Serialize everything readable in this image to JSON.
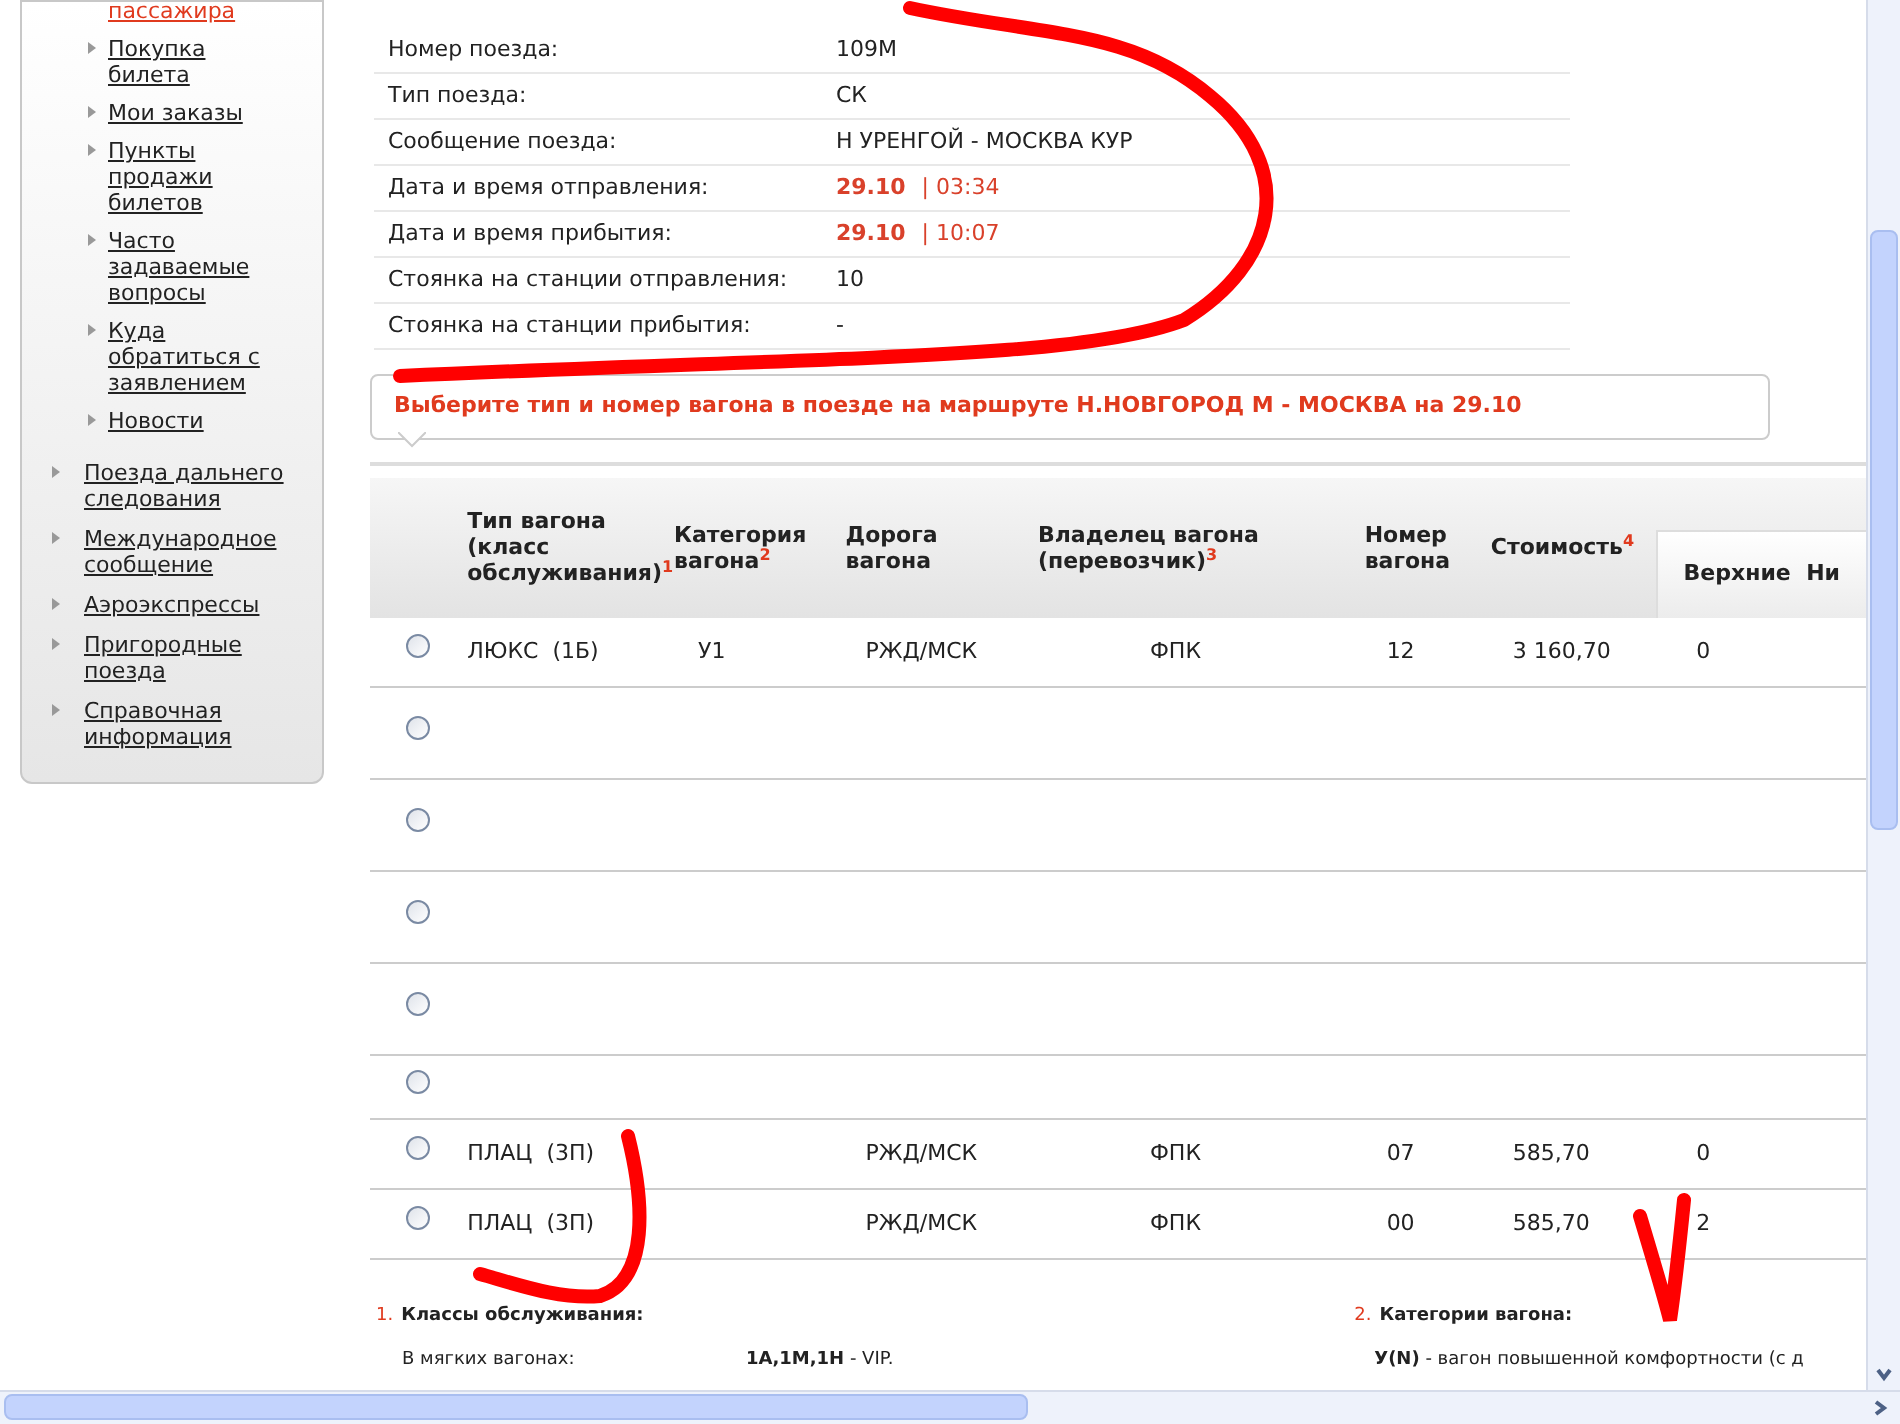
{
  "sidebar": {
    "items": [
      {
        "label": "пассажира",
        "selected": true
      },
      {
        "label": "Покупка билета",
        "selected": false
      },
      {
        "label": "Мои заказы",
        "selected": false
      },
      {
        "label": "Пункты продажи билетов",
        "selected": false
      },
      {
        "label": "Часто задаваемые вопросы",
        "selected": false
      },
      {
        "label": "Куда обратиться с заявлением",
        "selected": false
      },
      {
        "label": "Новости",
        "selected": false
      }
    ],
    "sections": [
      {
        "label": "Поезда дальнего следования"
      },
      {
        "label": "Международное сообщение"
      },
      {
        "label": "Аэроэкспрессы"
      },
      {
        "label": "Пригородные поезда"
      },
      {
        "label": "Справочная информация"
      }
    ]
  },
  "train_info": [
    {
      "label": "Номер поезда:",
      "value": "109М",
      "kind": "plain"
    },
    {
      "label": "Тип поезда:",
      "value": "СК",
      "kind": "plain"
    },
    {
      "label": "Сообщение поезда:",
      "value": "Н УРЕНГОЙ - МОСКВА КУР",
      "kind": "plain"
    },
    {
      "label": "Дата и время отправления:",
      "date": "29.10",
      "time": "| 03:34",
      "kind": "datetime"
    },
    {
      "label": "Дата и время прибытия:",
      "date": "29.10",
      "time": "| 10:07",
      "kind": "datetime"
    },
    {
      "label": "Стоянка на станции отправления:",
      "value": "10",
      "kind": "plain"
    },
    {
      "label": "Стоянка на станции прибытия:",
      "value": "-",
      "kind": "plain"
    }
  ],
  "notice": "Выберите тип и номер вагона в поезде на маршруте Н.НОВГОРОД М - МОСКВА на 29.10",
  "table": {
    "columns": [
      "Тип вагона (класс обслуживания)$^{1}$",
      "Категория вагона$^{2}$",
      "Дорога вагона",
      "Владелец вагона (перевозчик)$^{3}$",
      "Номер вагона",
      "Стоимость$^{4}$"
    ],
    "subcolumns": [
      "Верхние",
      "Ни"
    ],
    "rows": [
      {
        "selected": false,
        "cells": [
          "ЛЮКС  (1Б)",
          "У1",
          "РЖД/МСК",
          "ФПК",
          "12",
          "3 160,70",
          "0"
        ]
      },
      {
        "selected": false,
        "cells": []
      },
      {
        "selected": false,
        "cells": []
      },
      {
        "selected": false,
        "cells": []
      },
      {
        "selected": false,
        "cells": []
      },
      {
        "selected": false,
        "cells": []
      },
      {
        "selected": false,
        "cells": [
          "ПЛАЦ  (3П)",
          "",
          "РЖД/МСК",
          "ФПК",
          "07",
          "585,70",
          "0"
        ]
      },
      {
        "selected": false,
        "cells": [
          "ПЛАЦ  (3П)",
          "",
          "РЖД/МСК",
          "ФПК",
          "00",
          "585,70",
          "2"
        ]
      }
    ]
  },
  "footnotes": [
    {
      "number": "1.",
      "title": "Классы обслуживания:",
      "label": "В мягких вагонах:",
      "text": "**1А,1М,1Н** - VIP."
    },
    {
      "number": "2.",
      "title": "Категории вагона:",
      "text": "**У(N)** - вагон повышенной комфортности (с д"
    }
  ]
}
